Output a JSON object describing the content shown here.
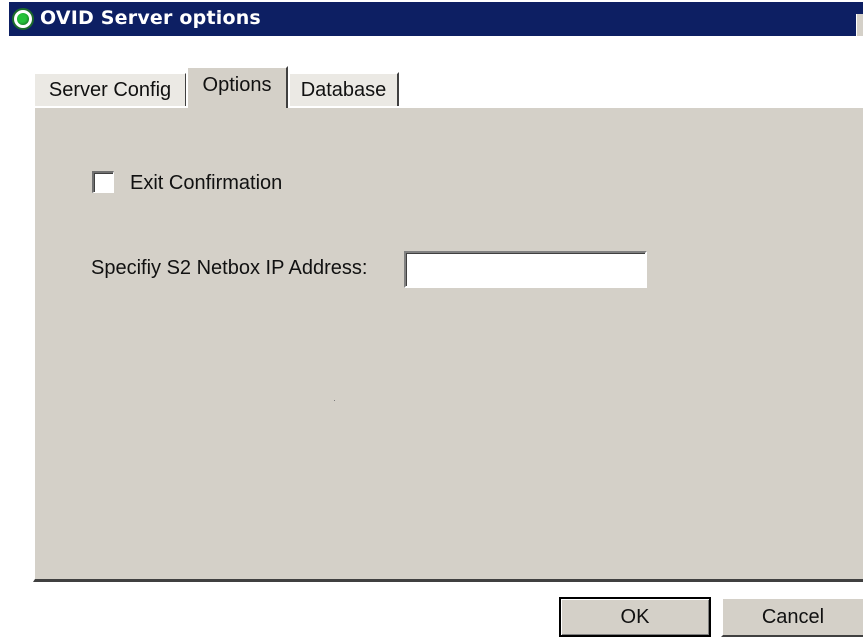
{
  "window": {
    "title": "OVID Server options"
  },
  "tabs": [
    {
      "label": "Server Config",
      "active": false
    },
    {
      "label": "Options",
      "active": true
    },
    {
      "label": "Database",
      "active": false
    }
  ],
  "options": {
    "exit_confirmation": {
      "label": "Exit Confirmation",
      "checked": false
    },
    "netbox_ip": {
      "label": "Specifiy S2 Netbox IP Address:",
      "value": ""
    }
  },
  "buttons": {
    "ok_label": "OK",
    "cancel_label": "Cancel"
  },
  "colors": {
    "titlebar": "#0d1f63",
    "panel": "#d4d0c8"
  },
  "icons": {
    "title_icon": "green-circle-icon"
  }
}
